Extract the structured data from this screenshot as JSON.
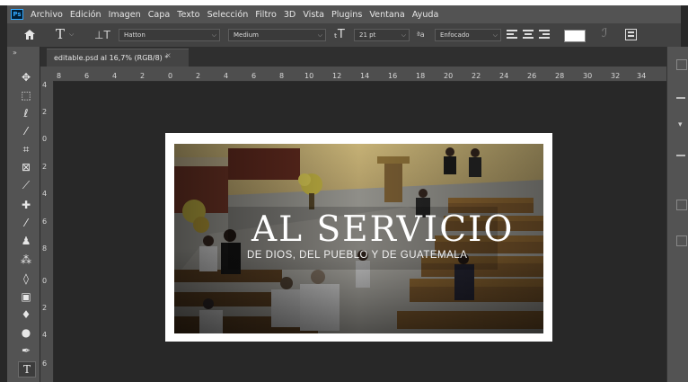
{
  "menu": [
    "Archivo",
    "Edición",
    "Imagen",
    "Capa",
    "Texto",
    "Selección",
    "Filtro",
    "3D",
    "Vista",
    "Plugins",
    "Ventana",
    "Ayuda"
  ],
  "app_logo": "Ps",
  "options": {
    "font_family": "Hatton",
    "font_style": "Medium",
    "font_size": "21 pt",
    "antialias": "Enfocado",
    "aa_icon_label": "ªa",
    "text_color": "#ffffff"
  },
  "document_tab": {
    "title": "editable.psd al 16,7% (RGB/8) *",
    "close": "×"
  },
  "ruler_h": [
    "8",
    "6",
    "4",
    "2",
    "0",
    "2",
    "4",
    "6",
    "8",
    "10",
    "12",
    "14",
    "16",
    "18",
    "20",
    "22",
    "24",
    "26",
    "28",
    "30",
    "32",
    "34"
  ],
  "ruler_v": [
    "4",
    "2",
    "0",
    "2",
    "4",
    "6",
    "8",
    "0",
    "2",
    "4",
    "6"
  ],
  "artwork": {
    "headline": "AL SERVICIO",
    "subtitle": "DE DIOS, DEL PUEBLO Y DE GUATEMALA"
  },
  "tools": [
    "move-icon",
    "marquee-icon",
    "lasso-icon",
    "magic-wand-icon",
    "crop-icon",
    "frame-icon",
    "eyedropper-icon",
    "healing-icon",
    "brush-icon",
    "stamp-icon",
    "history-brush-icon",
    "eraser-icon",
    "gradient-icon",
    "blur-icon",
    "dodge-icon",
    "pen-icon",
    "type-icon"
  ],
  "colors": {
    "accent": "#31a8ff",
    "panel": "#535353",
    "canvas": "#282828"
  }
}
